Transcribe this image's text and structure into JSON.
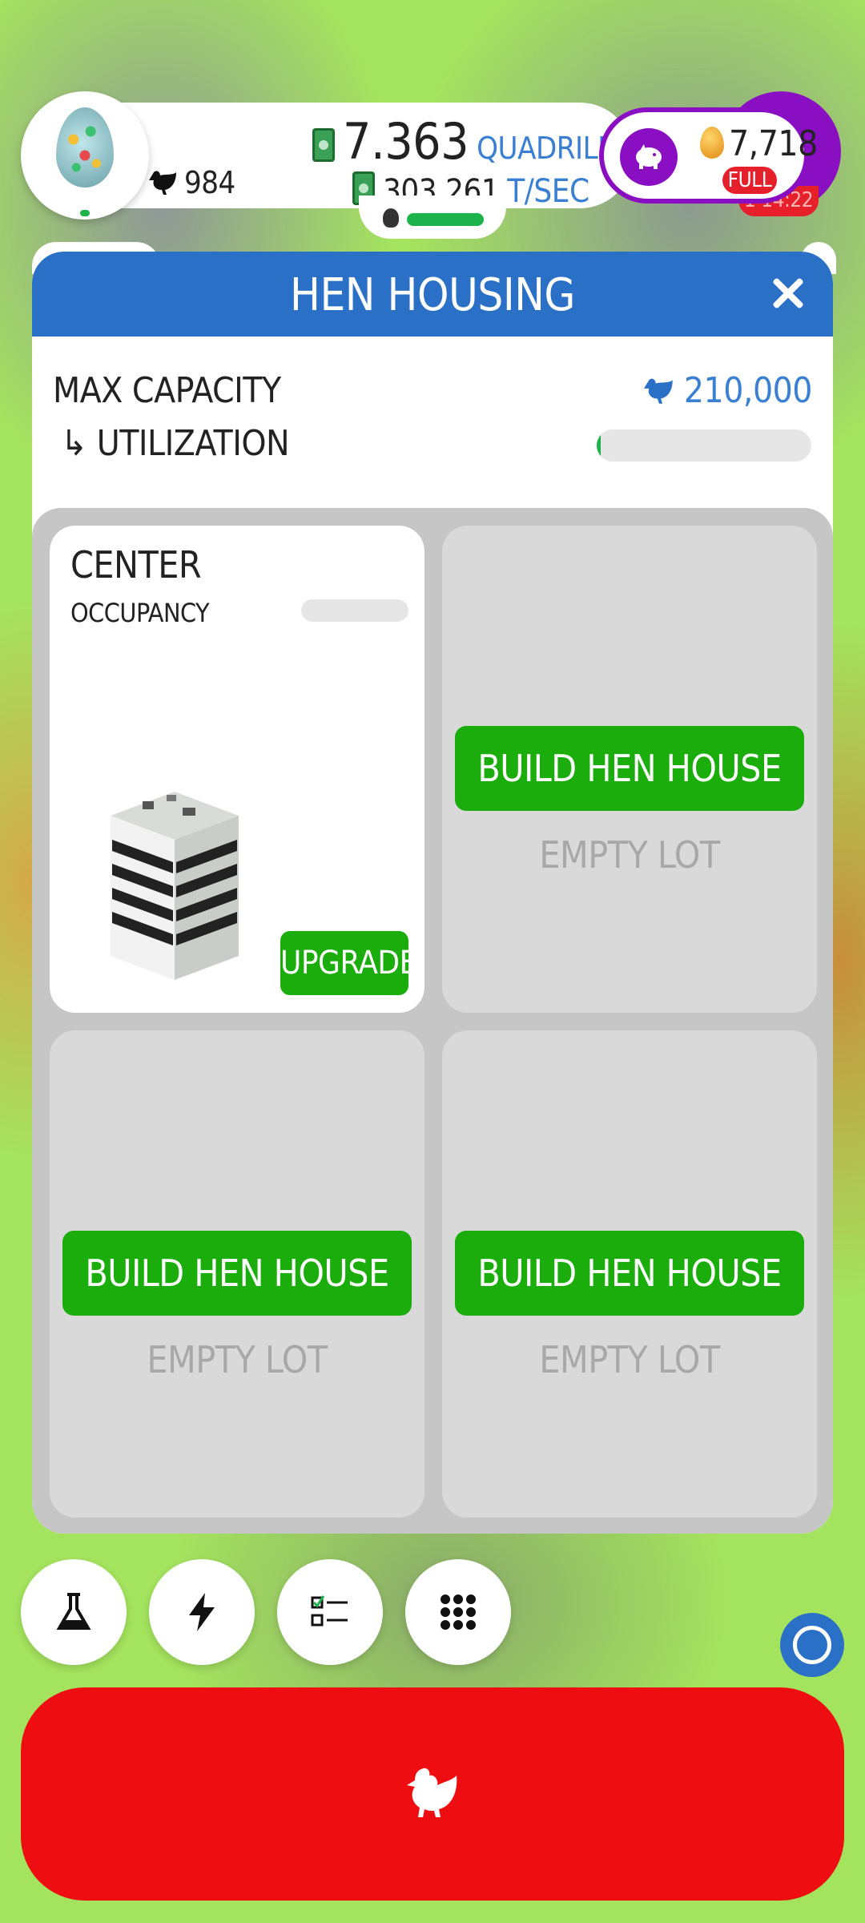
{
  "hud": {
    "chicken_count": "984",
    "cash_value": "7.363",
    "cash_unit": "QUADRILLION",
    "rate_value": "303.261",
    "rate_unit": "T/SEC",
    "piggy_eggs": "7,718",
    "piggy_status": "FULL",
    "timer": "1 14:22",
    "hatchery_progress": 1.0
  },
  "modal": {
    "title": "HEN HOUSING",
    "max_capacity_label": "MAX CAPACITY",
    "utilization_label": "↳ UTILIZATION",
    "max_capacity_value": "210,000",
    "utilization": 0.02
  },
  "lots": [
    {
      "built": true,
      "name": "CENTER",
      "occupancy_label": "OCCUPANCY",
      "occupancy": 0.0,
      "upgrade_label": "UPGRADE"
    },
    {
      "built": false,
      "build_label": "BUILD HEN HOUSE",
      "empty_label": "EMPTY LOT"
    },
    {
      "built": false,
      "build_label": "BUILD HEN HOUSE",
      "empty_label": "EMPTY LOT"
    },
    {
      "built": false,
      "build_label": "BUILD HEN HOUSE",
      "empty_label": "EMPTY LOT"
    }
  ],
  "bottom_buttons": [
    "flask-icon",
    "lightning-icon",
    "checklist-icon",
    "grid-menu-icon"
  ],
  "colors": {
    "header_blue": "#2b70c7",
    "build_green": "#1aad0c",
    "hatch_red": "#ee0e12",
    "piggy_purple": "#8a0fc2"
  }
}
